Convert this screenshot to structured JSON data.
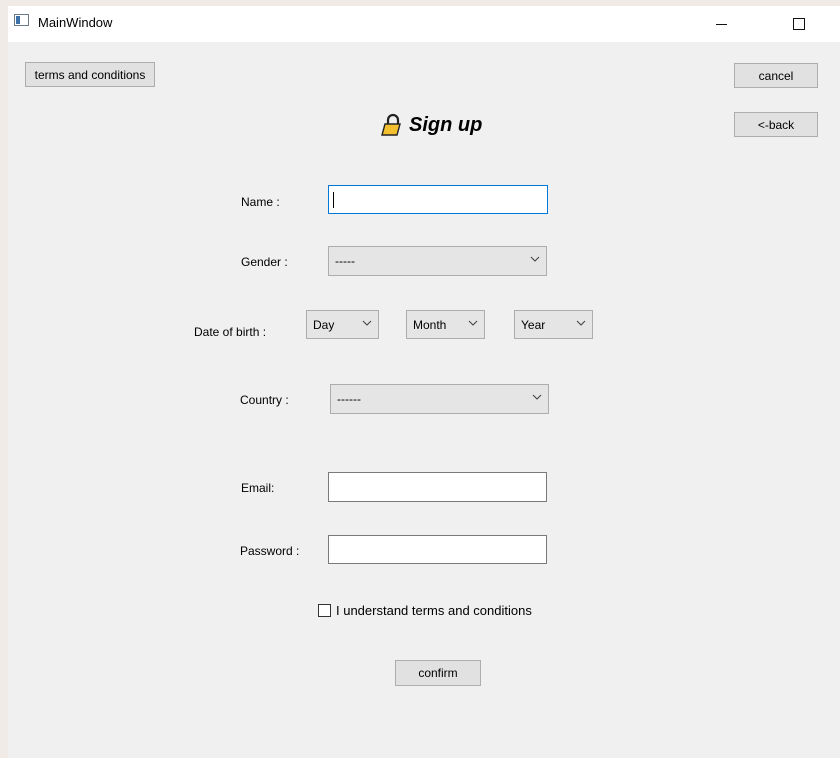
{
  "window": {
    "title": "MainWindow",
    "icon": "app-window-icon"
  },
  "toolbar": {
    "terms_label": "terms and conditions",
    "cancel_label": "cancel",
    "back_label": "<-back"
  },
  "heading": {
    "text": "Sign up",
    "icon": "lock-icon",
    "icon_color": "#f2c02e"
  },
  "form": {
    "name": {
      "label": "Name :",
      "value": "",
      "placeholder": ""
    },
    "gender": {
      "label": "Gender :",
      "selected": "-----"
    },
    "dob": {
      "label": "Date of birth :",
      "day": "Day",
      "month": "Month",
      "year": "Year"
    },
    "country": {
      "label": "Country :",
      "selected": "------"
    },
    "email": {
      "label": "Email:",
      "value": ""
    },
    "password": {
      "label": "Password :",
      "value": ""
    },
    "agree": {
      "label": "I understand terms  and conditions",
      "checked": false
    },
    "confirm_label": "confirm"
  },
  "colors": {
    "focus_border": "#0078d7",
    "button_bg": "#e1e1e1",
    "window_bg": "#f0f0f0"
  }
}
